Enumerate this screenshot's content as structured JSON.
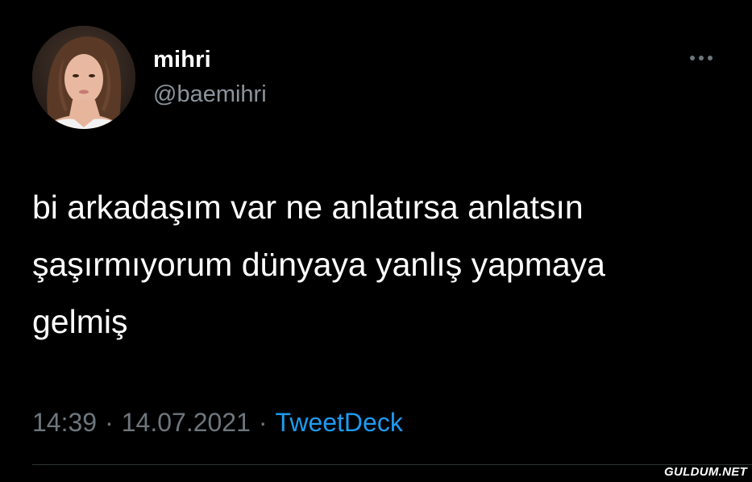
{
  "user": {
    "display_name": "mihri",
    "handle": "@baemihri"
  },
  "tweet": {
    "text": "bi arkadaşım var ne anlatırsa anlatsın\nşaşırmıyorum dünyaya yanlış yapmaya\ngelmiş",
    "time": "14:39",
    "date": "14.07.2021",
    "separator": "·",
    "source": "TweetDeck"
  },
  "icons": {
    "more": "more-horizontal-icon",
    "avatar": "avatar-image"
  },
  "watermark": "GULDUM.NET",
  "colors": {
    "background": "#000000",
    "text": "#ffffff",
    "muted": "#8b949c",
    "link": "#1d9bf0"
  }
}
